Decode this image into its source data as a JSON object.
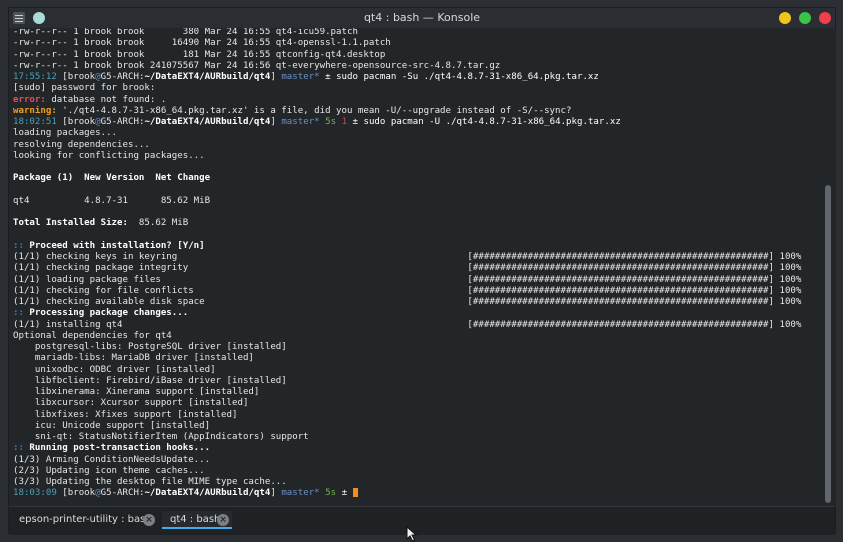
{
  "window": {
    "title": "qt4 : bash — Konsole"
  },
  "terminal": {
    "lines": [
      [
        {
          "t": "-rw-r--r-- 1 brook brook       380 Mar 24 16:55 qt4-icu59.patch"
        }
      ],
      [
        {
          "t": "-rw-r--r-- 1 brook brook     16490 Mar 24 16:55 qt4-openssl-1.1.patch"
        }
      ],
      [
        {
          "t": "-rw-r--r-- 1 brook brook       181 Mar 24 16:55 qtconfig-qt4.desktop"
        }
      ],
      [
        {
          "t": "-rw-r--r-- 1 brook brook 241075567 Mar 24 16:56 qt-everywhere-opensource-src-4.8.7.tar.gz"
        }
      ],
      [
        {
          "t": "17:55:12",
          "c": "c-time"
        },
        {
          "t": " [brook"
        },
        {
          "t": "@",
          "c": "c-git"
        },
        {
          "t": "G5-ARCH"
        },
        {
          "t": ":"
        },
        {
          "t": "~/DataEXT4/AURbuild/qt4",
          "c": "c-path"
        },
        {
          "t": "] "
        },
        {
          "t": "master*",
          "c": "c-git"
        },
        {
          "t": " ± sudo pacman -Su ./qt4-4.8.7-31-x86_64.pkg.tar.xz",
          "c": "c-white"
        }
      ],
      [
        {
          "t": "[sudo] password for brook:"
        }
      ],
      [
        {
          "t": "error:",
          "c": "c-err"
        },
        {
          "t": " database not found: ."
        }
      ],
      [
        {
          "t": "warning:",
          "c": "c-warn"
        },
        {
          "t": " './qt4-4.8.7-31-x86_64.pkg.tar.xz' is a file, did you mean -U/--upgrade instead of -S/--sync?"
        }
      ],
      [
        {
          "t": "18:02:51",
          "c": "c-time"
        },
        {
          "t": " [brook"
        },
        {
          "t": "@",
          "c": "c-git"
        },
        {
          "t": "G5-ARCH"
        },
        {
          "t": ":"
        },
        {
          "t": "~/DataEXT4/AURbuild/qt4",
          "c": "c-path"
        },
        {
          "t": "] "
        },
        {
          "t": "master*",
          "c": "c-git"
        },
        {
          "t": " "
        },
        {
          "t": "5s",
          "c": "c-green"
        },
        {
          "t": " "
        },
        {
          "t": "1",
          "c": "c-red"
        },
        {
          "t": " ± sudo pacman -U ./qt4-4.8.7-31-x86_64.pkg.tar.xz",
          "c": "c-white"
        }
      ],
      [
        {
          "t": "loading packages..."
        }
      ],
      [
        {
          "t": "resolving dependencies..."
        }
      ],
      [
        {
          "t": "looking for conflicting packages..."
        }
      ],
      [
        {
          "t": ""
        }
      ],
      [
        {
          "t": "Package (1)  New Version  Net Change",
          "c": "c-bold"
        }
      ],
      [
        {
          "t": ""
        }
      ],
      [
        {
          "t": "qt4          4.8.7-31      85.62 MiB"
        }
      ],
      [
        {
          "t": ""
        }
      ],
      [
        {
          "t": "Total Installed Size:",
          "c": "c-bold"
        },
        {
          "t": "  85.62 MiB"
        }
      ],
      [
        {
          "t": ""
        }
      ],
      [
        {
          "t": "::",
          "c": "c-blue"
        },
        {
          "t": " Proceed with installation? [Y/n]",
          "c": "c-bold"
        }
      ],
      [
        {
          "t": "(1/1) checking keys in keyring                                                     [######################################################] 100%"
        }
      ],
      [
        {
          "t": "(1/1) checking package integrity                                                   [######################################################] 100%"
        }
      ],
      [
        {
          "t": "(1/1) loading package files                                                        [######################################################] 100%"
        }
      ],
      [
        {
          "t": "(1/1) checking for file conflicts                                                  [######################################################] 100%"
        }
      ],
      [
        {
          "t": "(1/1) checking available disk space                                                [######################################################] 100%"
        }
      ],
      [
        {
          "t": "::",
          "c": "c-blue"
        },
        {
          "t": " Processing package changes...",
          "c": "c-bold"
        }
      ],
      [
        {
          "t": "(1/1) installing qt4                                                               [######################################################] 100%"
        }
      ],
      [
        {
          "t": "Optional dependencies for qt4"
        }
      ],
      [
        {
          "t": "    postgresql-libs: PostgreSQL driver [installed]"
        }
      ],
      [
        {
          "t": "    mariadb-libs: MariaDB driver [installed]"
        }
      ],
      [
        {
          "t": "    unixodbc: ODBC driver [installed]"
        }
      ],
      [
        {
          "t": "    libfbclient: Firebird/iBase driver [installed]"
        }
      ],
      [
        {
          "t": "    libxinerama: Xinerama support [installed]"
        }
      ],
      [
        {
          "t": "    libxcursor: Xcursor support [installed]"
        }
      ],
      [
        {
          "t": "    libxfixes: Xfixes support [installed]"
        }
      ],
      [
        {
          "t": "    icu: Unicode support [installed]"
        }
      ],
      [
        {
          "t": "    sni-qt: StatusNotifierItem (AppIndicators) support"
        }
      ],
      [
        {
          "t": "::",
          "c": "c-blue"
        },
        {
          "t": " Running post-transaction hooks...",
          "c": "c-bold"
        }
      ],
      [
        {
          "t": "(1/3) Arming ConditionNeedsUpdate..."
        }
      ],
      [
        {
          "t": "(2/3) Updating icon theme caches..."
        }
      ],
      [
        {
          "t": "(3/3) Updating the desktop file MIME type cache..."
        }
      ],
      [
        {
          "t": "18:03:09",
          "c": "c-time"
        },
        {
          "t": " [brook"
        },
        {
          "t": "@",
          "c": "c-git"
        },
        {
          "t": "G5-ARCH"
        },
        {
          "t": ":"
        },
        {
          "t": "~/DataEXT4/AURbuild/qt4",
          "c": "c-path"
        },
        {
          "t": "] "
        },
        {
          "t": "master*",
          "c": "c-git"
        },
        {
          "t": " "
        },
        {
          "t": "5s",
          "c": "c-green"
        },
        {
          "t": " ± ",
          "c": "c-white"
        }
      ]
    ]
  },
  "tabs": [
    {
      "label": "epson-printer-utility : bash",
      "active": false
    },
    {
      "label": "qt4 : bash",
      "active": true
    }
  ],
  "icons": {
    "menu": "window-menu-icon",
    "pin": "keep-above-icon",
    "minimize": "minimize-icon",
    "maximize": "maximize-icon",
    "close": "close-icon",
    "tab_close": "tab-close-icon",
    "mouse": "mouse-pointer-icon"
  },
  "colors": {
    "minimize": "#f0c418",
    "maximize": "#38c448",
    "close": "#ee3f4c",
    "accent": "#3daee9"
  }
}
